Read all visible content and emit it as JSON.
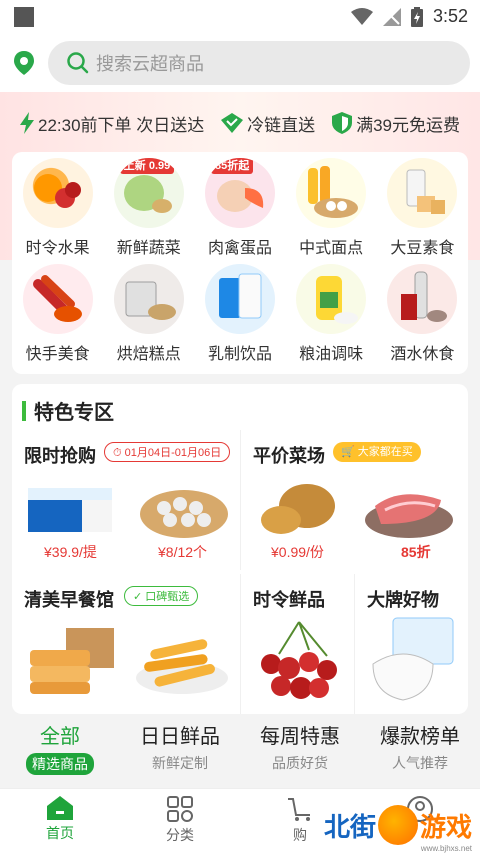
{
  "status": {
    "time": "3:52"
  },
  "search": {
    "placeholder": "搜索云超商品"
  },
  "promo": [
    {
      "text": "22:30前下单 次日送达"
    },
    {
      "text": "冷链直送"
    },
    {
      "text": "满39元免运费"
    }
  ],
  "categories": [
    {
      "label": "时令水果"
    },
    {
      "label": "新鲜蔬菜",
      "badge": "上新 0.99"
    },
    {
      "label": "肉禽蛋品",
      "badge": "85折起"
    },
    {
      "label": "中式面点"
    },
    {
      "label": "大豆素食"
    },
    {
      "label": "快手美食"
    },
    {
      "label": "烘焙糕点"
    },
    {
      "label": "乳制饮品"
    },
    {
      "label": "粮油调味"
    },
    {
      "label": "酒水休食"
    }
  ],
  "feature": {
    "title": "特色专区",
    "flash": {
      "title": "限时抢购",
      "tag": "01月04日-01月06日",
      "price1": "¥39.9/提",
      "price2": "¥8/12个"
    },
    "cheap": {
      "title": "平价菜场",
      "tag": "大家都在买",
      "price1": "¥0.99/份",
      "price2": "85折"
    },
    "breakfast": {
      "title": "清美早餐馆",
      "tag": "口碑甄选"
    },
    "seasonal": {
      "title": "时令鲜品"
    },
    "brand": {
      "title": "大牌好物"
    }
  },
  "tabs": [
    {
      "main": "全部",
      "sub": "精选商品"
    },
    {
      "main": "日日鲜品",
      "sub": "新鲜定制"
    },
    {
      "main": "每周特惠",
      "sub": "品质好货"
    },
    {
      "main": "爆款榜单",
      "sub": "人气推荐"
    }
  ],
  "nav": [
    {
      "label": "首页"
    },
    {
      "label": "分类"
    },
    {
      "label": "购"
    },
    {
      "label": ""
    }
  ],
  "watermark": {
    "a": "北街",
    "b": "游戏",
    "url": "www.bjhxs.net"
  },
  "colors": {
    "accent": "#1fa43b",
    "price": "#e53935"
  }
}
